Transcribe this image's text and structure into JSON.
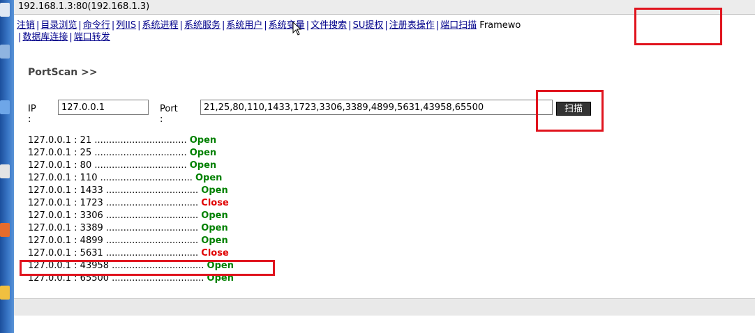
{
  "window": {
    "title": "192.168.1.3:80(192.168.1.3)"
  },
  "nav": {
    "items": [
      "注销",
      "目录浏览",
      "命令行",
      "列IIS",
      "系统进程",
      "系统服务",
      "系统用户",
      "系统变量",
      "文件搜索",
      "SU提权",
      "注册表操作",
      "端口扫描"
    ],
    "trailing_text": "Framewo",
    "items_line2": [
      "数据库连接",
      "端口转发"
    ]
  },
  "portscan": {
    "heading": "PortScan >>",
    "ip_label": "IP :",
    "ip_value": "127.0.0.1",
    "port_label": "Port :",
    "port_value": "21,25,80,110,1433,1723,3306,3389,4899,5631,43958,65500",
    "scan_button": "扫描"
  },
  "results": [
    {
      "addr": "127.0.0.1 : 21",
      "dots": "................................",
      "status": "Open"
    },
    {
      "addr": "127.0.0.1 : 25",
      "dots": "................................",
      "status": "Open"
    },
    {
      "addr": "127.0.0.1 : 80",
      "dots": "................................",
      "status": "Open"
    },
    {
      "addr": "127.0.0.1 : 110",
      "dots": "................................",
      "status": "Open"
    },
    {
      "addr": "127.0.0.1 : 1433",
      "dots": "................................",
      "status": "Open"
    },
    {
      "addr": "127.0.0.1 : 1723",
      "dots": "................................",
      "status": "Close"
    },
    {
      "addr": "127.0.0.1 : 3306",
      "dots": "................................",
      "status": "Open"
    },
    {
      "addr": "127.0.0.1 : 3389",
      "dots": "................................",
      "status": "Open"
    },
    {
      "addr": "127.0.0.1 : 4899",
      "dots": "................................",
      "status": "Open"
    },
    {
      "addr": "127.0.0.1 : 5631",
      "dots": "................................",
      "status": "Close"
    },
    {
      "addr": "127.0.0.1 : 43958",
      "dots": "................................",
      "status": "Open"
    },
    {
      "addr": "127.0.0.1 : 65500",
      "dots": "................................",
      "status": "Open"
    }
  ],
  "colors": {
    "open": "#008000",
    "close": "#e00000",
    "highlight": "#e0141e",
    "link": "#00008b"
  }
}
